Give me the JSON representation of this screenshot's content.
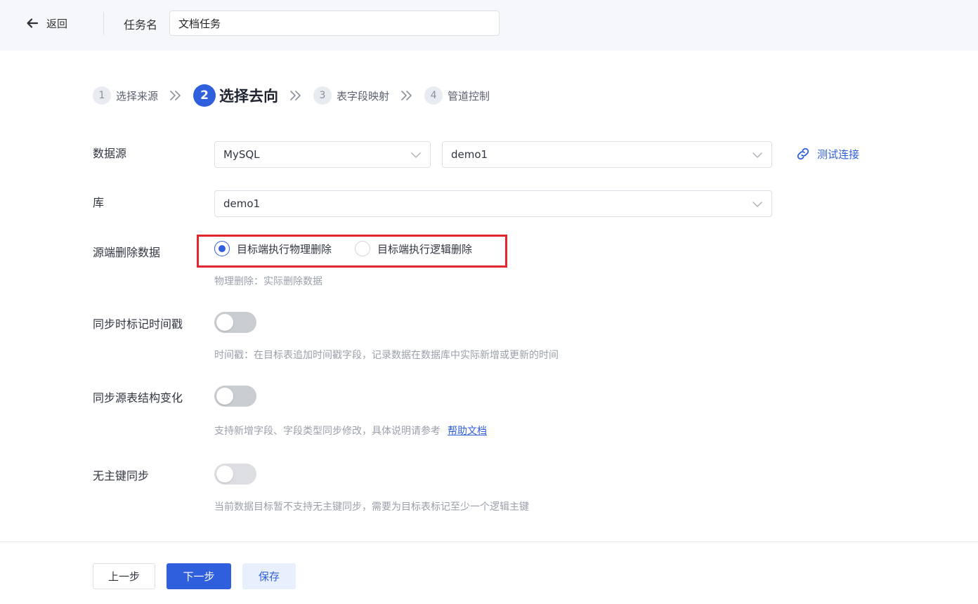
{
  "header": {
    "back_label": "返回",
    "task_name_label": "任务名",
    "task_name_value": "文档任务"
  },
  "steps": [
    {
      "num": "1",
      "label": "选择来源"
    },
    {
      "num": "2",
      "label": "选择去向"
    },
    {
      "num": "3",
      "label": "表字段映射"
    },
    {
      "num": "4",
      "label": "管道控制"
    }
  ],
  "active_step": 2,
  "form": {
    "datasource": {
      "label": "数据源",
      "type_value": "MySQL",
      "instance_value": "demo1",
      "test_link": "测试连接"
    },
    "database": {
      "label": "库",
      "value": "demo1"
    },
    "source_delete": {
      "label": "源端删除数据",
      "option_physical": "目标端执行物理删除",
      "option_logical": "目标端执行逻辑删除",
      "selected": "physical",
      "hint": "物理删除：实际删除数据"
    },
    "timestamp_sync": {
      "label": "同步时标记时间戳",
      "enabled": false,
      "hint": "时间戳：在目标表追加时间戳字段，记录数据在数据库中实际新增或更新的时间"
    },
    "schema_sync": {
      "label": "同步源表结构变化",
      "enabled": false,
      "hint": "支持新增字段、字段类型同步修改，具体说明请参考",
      "help_link": "帮助文档"
    },
    "no_pk_sync": {
      "label": "无主键同步",
      "enabled": false,
      "hint": "当前数据目标暂不支持无主键同步，需要为目标表标记至少一个逻辑主键"
    }
  },
  "footer": {
    "prev_label": "上一步",
    "next_label": "下一步",
    "save_label": "保存"
  },
  "colors": {
    "primary": "#2f5fdc",
    "highlight_border": "#e3262d",
    "header_bg": "#f5f7fa"
  }
}
